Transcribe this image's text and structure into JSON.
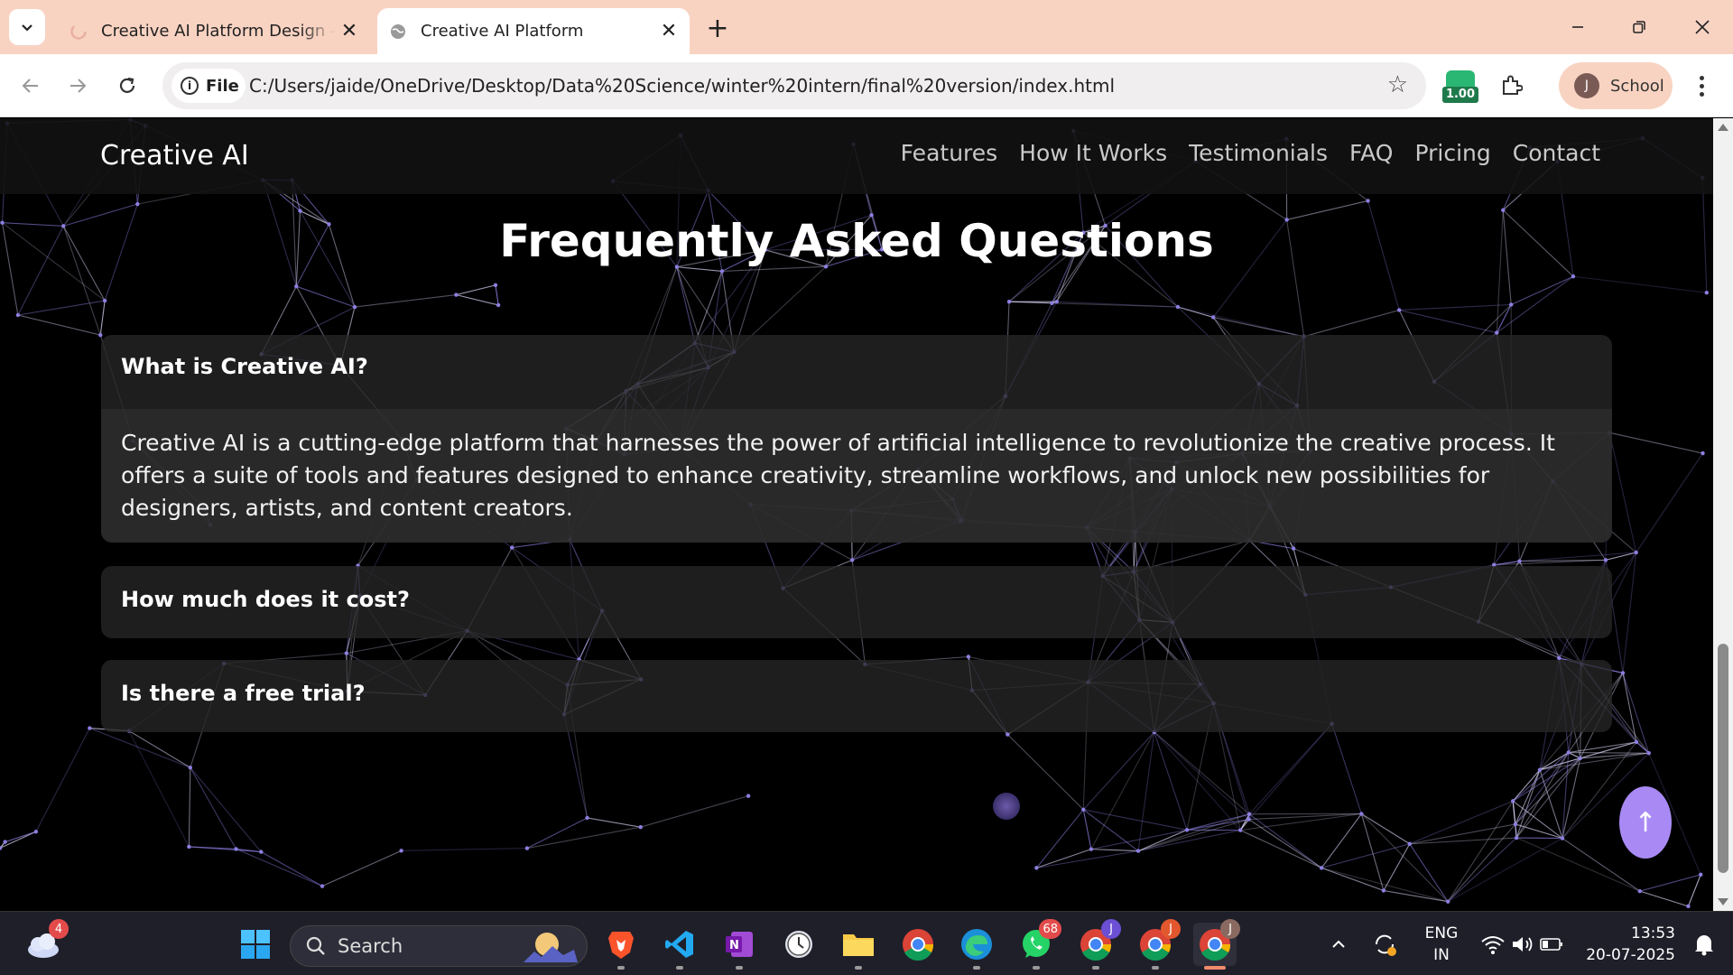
{
  "browser": {
    "tabs": [
      {
        "title": "Creative AI Platform Design - G",
        "active": false
      },
      {
        "title": "Creative AI Platform",
        "active": true
      }
    ],
    "site_chip_label": "File",
    "url": "C:/Users/jaide/OneDrive/Desktop/Data%20Science/winter%20intern/final%20version/index.html",
    "extension_badge": "1.00",
    "profile": {
      "initial": "J",
      "name": "School"
    }
  },
  "page": {
    "brand": "Creative AI",
    "nav": [
      "Features",
      "How It Works",
      "Testimonials",
      "FAQ",
      "Pricing",
      "Contact"
    ],
    "faq_title": "Frequently Asked Questions",
    "faqs": [
      {
        "question": "What is Creative AI?",
        "answer": "Creative AI is a cutting-edge platform that harnesses the power of artificial intelligence to revolutionize the creative process. It offers a suite of tools and features designed to enhance creativity, streamline workflows, and unlock new possibilities for designers, artists, and content creators.",
        "expanded": true
      },
      {
        "question": "How much does it cost?",
        "expanded": false
      },
      {
        "question": "Is there a free trial?",
        "expanded": false
      }
    ],
    "scroll_top_label": "↑",
    "accent_color": "#a98af5",
    "network_color": "#8b7fe0"
  },
  "taskbar": {
    "weather_badge": "4",
    "search_label": "Search",
    "whatsapp_badge": "68",
    "chrome_profile_initials": [
      "J",
      "J",
      "J"
    ],
    "language": {
      "line1": "ENG",
      "line2": "IN"
    },
    "time": "13:53",
    "date": "20-07-2025"
  }
}
